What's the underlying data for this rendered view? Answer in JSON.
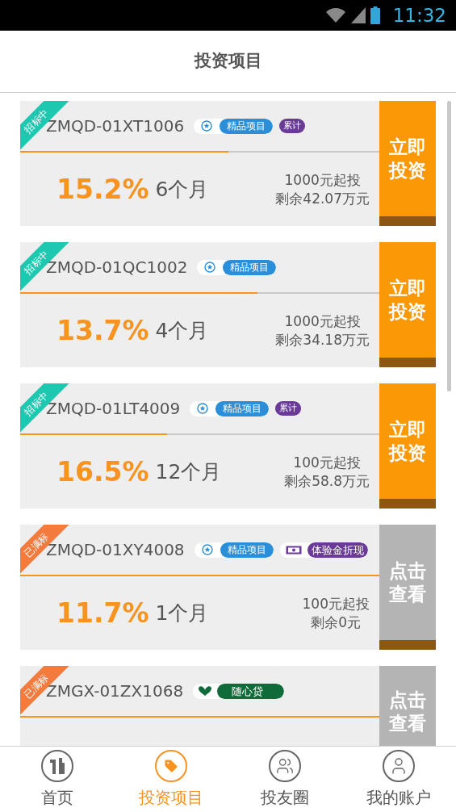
{
  "status_bar": {
    "time": "11:32"
  },
  "title": "投资项目",
  "projects": [
    {
      "status": {
        "label": "招标中",
        "color": "#1ec8b0"
      },
      "code": "ZMQD-01XT1006",
      "tags": [
        {
          "kind": "featured",
          "label": "精品项目"
        },
        {
          "kind": "cumulative",
          "label": "累计"
        }
      ],
      "level": 0.58,
      "rate": "15.2%",
      "period": "6个月",
      "min": "1000元起投",
      "remaining": "剩余42.07万元",
      "button": {
        "kind": "invest",
        "label": "立即投资"
      }
    },
    {
      "status": {
        "label": "招标中",
        "color": "#1ec8b0"
      },
      "code": "ZMQD-01QC1002",
      "tags": [
        {
          "kind": "featured",
          "label": "精品项目"
        }
      ],
      "level": 0.66,
      "rate": "13.7%",
      "period": "4个月",
      "min": "1000元起投",
      "remaining": "剩余34.18万元",
      "button": {
        "kind": "invest",
        "label": "立即投资"
      }
    },
    {
      "status": {
        "label": "招标中",
        "color": "#1ec8b0"
      },
      "code": "ZMQD-01LT4009",
      "tags": [
        {
          "kind": "featured",
          "label": "精品项目"
        },
        {
          "kind": "cumulative",
          "label": "累计"
        }
      ],
      "level": 0.41,
      "rate": "16.5%",
      "period": "12个月",
      "min": "100元起投",
      "remaining": "剩余58.8万元",
      "button": {
        "kind": "invest",
        "label": "立即投资"
      }
    },
    {
      "status": {
        "label": "已满标",
        "color": "#f47b3e"
      },
      "code": "ZMQD-01XY4008",
      "tags": [
        {
          "kind": "featured",
          "label": "精品项目"
        },
        {
          "kind": "cash",
          "label": "体验金折现"
        }
      ],
      "level": 1,
      "rate": "11.7%",
      "period": "1个月",
      "min": "100元起投",
      "remaining": "剩余0元",
      "button": {
        "kind": "view",
        "label": "点击查看"
      }
    },
    {
      "status": {
        "label": "已满标",
        "color": "#f47b3e"
      },
      "code": "ZMGX-01ZX1068",
      "tags": [
        {
          "kind": "flex",
          "label": "随心贷"
        }
      ],
      "level": 1,
      "button": {
        "kind": "view",
        "label": "点击查看"
      }
    }
  ],
  "nav": [
    {
      "label": "首页",
      "selected": false
    },
    {
      "label": "投资项目",
      "selected": true
    },
    {
      "label": "投友圈",
      "selected": false
    },
    {
      "label": "我的账户",
      "selected": false
    }
  ]
}
